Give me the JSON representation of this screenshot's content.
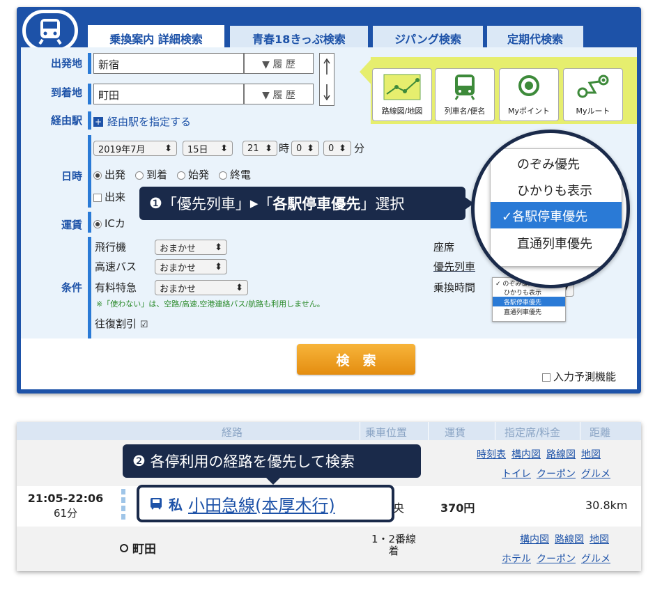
{
  "tabs": [
    {
      "label": "乗換案内 詳細検索",
      "active": true
    },
    {
      "label": "青春18きっぷ検索",
      "active": false
    },
    {
      "label": "ジパング検索",
      "active": false
    },
    {
      "label": "定期代検索",
      "active": false
    }
  ],
  "form": {
    "from_label": "出発地",
    "from_value": "新宿",
    "to_label": "到着地",
    "to_value": "町田",
    "history_label": "▼ 履 歴",
    "via_label": "経由駅",
    "via_link": "経由駅を指定する",
    "date_label": "日時",
    "year_month": "2019年7月",
    "day": "15日",
    "hour": "21",
    "hour_unit": "時",
    "min1": "0",
    "min2": "0",
    "min_unit": "分",
    "time_types": [
      "出発",
      "到着",
      "始発",
      "終電"
    ],
    "unknown_partial": "出来",
    "fare_label": "運賃",
    "fare_partial": "ICカ",
    "cond_label": "条件",
    "airplane": "飛行機",
    "highway_bus": "高速バス",
    "ltd_express": "有料特急",
    "auto": "おまかせ",
    "note": "※「使わない」は、空路/高速,空港連絡バス/航路も利用しません。",
    "round_trip": "往復割引",
    "seat": "座席",
    "priority_train": "優先列車",
    "transfer_time": "乗換時間",
    "search_button": "検　索",
    "predict": "入力予測機能"
  },
  "tools": [
    "路線図/地図",
    "列車名/便名",
    "Myポイント",
    "Myルート"
  ],
  "dropdown": {
    "options": [
      "のぞみ優先",
      "ひかりも表示",
      "各駅停車優先",
      "直通列車優先"
    ],
    "selected": "各駅停車優先",
    "check": "✓"
  },
  "mini_dropdown": {
    "options": [
      "のぞみ優先",
      "ひかりも表示",
      "各駅停車優先",
      "直通列車優先"
    ],
    "selected": "各駅停車優先",
    "check": "✓"
  },
  "callout1": {
    "num": "❶",
    "part1": "「優先列車」",
    "arrow": "▶",
    "part2": "「",
    "bold": "各駅停車優先",
    "part3": "」選択"
  },
  "callout2": {
    "num": "❷",
    "text": "各停利用の経路を優先して検索"
  },
  "table": {
    "headers": [
      "経路",
      "乗車位置",
      "運賃",
      "指定席/料金",
      "距離"
    ],
    "row1_links": [
      "時刻表",
      "構内図",
      "路線図",
      "地図"
    ],
    "row1_links2": [
      "トイレ",
      "クーポン",
      "グルメ"
    ],
    "time": "21:05-22:06",
    "duration": "61分",
    "line_mark": "私",
    "line_name": "小田急線(本厚木行)",
    "position_partial": "央",
    "fare": "370円",
    "distance": "30.8km",
    "arrive_station": "町田",
    "platform": "1・2番線",
    "platform2": "着",
    "row3_links": [
      "構内図",
      "路線図",
      "地図"
    ],
    "row3_links2": [
      "ホテル",
      "クーポン",
      "グルメ"
    ]
  },
  "colors": {
    "brand": "#1d52a8",
    "accent": "#f0a020",
    "callout": "#1a2a4a",
    "toolbar": "#e6ee6e"
  }
}
